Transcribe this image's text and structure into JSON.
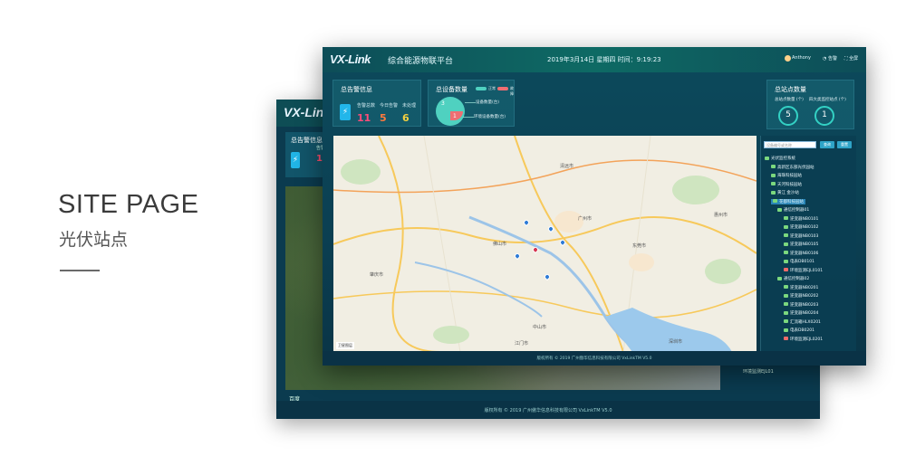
{
  "hero": {
    "title": "SITE PAGE",
    "subtitle": "光伏站点"
  },
  "back_window": {
    "logo": "VX-Link",
    "alarm_title": "总告警信息",
    "alarm_label": "告警总",
    "alarm_count": "11",
    "map_logo": "百度",
    "tree_item": "环境监测EJL01",
    "footer": "版权所有 © 2019 广州傲华信息科技有限公司 VxLinkTM V5.0"
  },
  "header": {
    "logo": "VX-Link",
    "title": "综合能源物联平台",
    "datetime": "2019年3月14日 星期四  时间：9:19:23",
    "user": "Anthony",
    "alert_label": "告警",
    "fullscreen_label": "全屏"
  },
  "alarm_card": {
    "title": "总告警信息",
    "columns": [
      {
        "label": "告警总数",
        "value": "11",
        "color": "#ff4d7a"
      },
      {
        "label": "今日告警",
        "value": "5",
        "color": "#ff7a3d"
      },
      {
        "label": "未处理",
        "value": "6",
        "color": "#f4d03f"
      }
    ]
  },
  "device_card": {
    "title": "总设备数量",
    "legend_normal": "正常",
    "legend_fault": "故障",
    "pie_normal": "3",
    "pie_fault": "1",
    "line1": "设备数量(台)",
    "line2": "环境设备数量(台)",
    "colors": {
      "normal": "#4fd1c0",
      "fault": "#ef6e72"
    }
  },
  "site_card": {
    "title": "总站点数量",
    "label1": "总站点数量 (个)",
    "label2": "四大类监控站点 (个)",
    "value1": "5",
    "value2": "1"
  },
  "map": {
    "copyright": "卫星图层",
    "places": [
      "广州市",
      "佛山市",
      "东莞市",
      "深圳市",
      "中山市",
      "江门市",
      "惠州市",
      "肇庆市",
      "清远市"
    ],
    "markers": [
      {
        "lat": 23.16,
        "lng": 113.28,
        "color": "#2e7bd6"
      },
      {
        "lat": 23.14,
        "lng": 113.36,
        "color": "#2e7bd6"
      },
      {
        "lat": 23.08,
        "lng": 113.31,
        "color": "#d6334f"
      },
      {
        "lat": 23.06,
        "lng": 113.25,
        "color": "#2e7bd6"
      },
      {
        "lat": 23.1,
        "lng": 113.4,
        "color": "#2e7bd6"
      },
      {
        "lat": 23.0,
        "lng": 113.35,
        "color": "#2e7bd6"
      }
    ]
  },
  "tree": {
    "search_placeholder": "设备编号或名称",
    "search_button": "查询",
    "reset_button": "重置",
    "items": [
      {
        "label": "光伏监控系统",
        "level": 0,
        "icon": "folder"
      },
      {
        "label": "高新区东部光伏园站",
        "level": 1,
        "icon": "ok"
      },
      {
        "label": "海珠科技园站",
        "level": 1,
        "icon": "ok"
      },
      {
        "label": "天河科技园站",
        "level": 1,
        "icon": "ok"
      },
      {
        "label": "黄江 金沙站",
        "level": 1,
        "icon": "ok"
      },
      {
        "label": "花都科技园站",
        "level": 1,
        "icon": "ok",
        "selected": true
      },
      {
        "label": "通信控制器01",
        "level": 2,
        "icon": "ok"
      },
      {
        "label": "逆变器NB0101",
        "level": 3,
        "icon": "ok"
      },
      {
        "label": "逆变器NB0102",
        "level": 3,
        "icon": "ok"
      },
      {
        "label": "逆变器NB0103",
        "level": 3,
        "icon": "ok"
      },
      {
        "label": "逆变器NB0105",
        "level": 3,
        "icon": "ok"
      },
      {
        "label": "逆变器NB0106",
        "level": 3,
        "icon": "ok"
      },
      {
        "label": "电表DB0101",
        "level": 3,
        "icon": "ok"
      },
      {
        "label": "环境监测EJL0101",
        "level": 3,
        "icon": "red"
      },
      {
        "label": "通信控制器02",
        "level": 2,
        "icon": "ok"
      },
      {
        "label": "逆变器NB0201",
        "level": 3,
        "icon": "ok"
      },
      {
        "label": "逆变器NB0202",
        "level": 3,
        "icon": "ok"
      },
      {
        "label": "逆变器NB0203",
        "level": 3,
        "icon": "ok"
      },
      {
        "label": "逆变器NB0204",
        "level": 3,
        "icon": "ok"
      },
      {
        "label": "汇流箱HLX0201",
        "level": 3,
        "icon": "ok"
      },
      {
        "label": "电表DB0201",
        "level": 3,
        "icon": "ok"
      },
      {
        "label": "环境监测EJL0201",
        "level": 3,
        "icon": "red"
      }
    ]
  },
  "footer": "版权所有 © 2019 广州傲华信息科技有限公司 VxLinkTM V5.0"
}
